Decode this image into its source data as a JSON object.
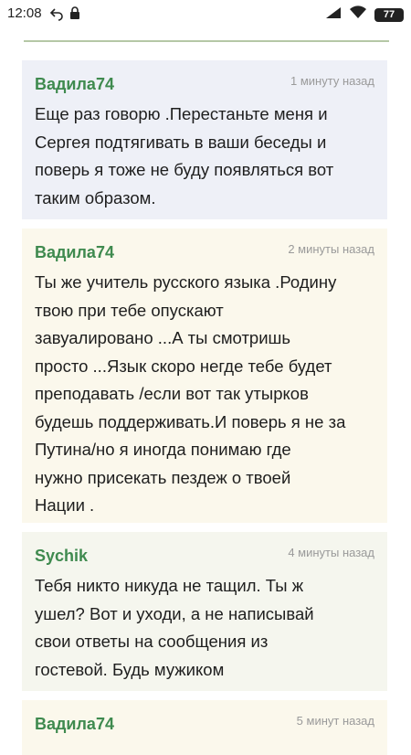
{
  "status_bar": {
    "time": "12:08",
    "icons": [
      "back-arrow-icon",
      "lock-icon",
      "signal-icon",
      "wifi-icon",
      "battery-icon"
    ],
    "battery": "77"
  },
  "comments": [
    {
      "author": "Вадила74",
      "time": "1 минуту назад",
      "lines": [
        "Еще раз говорю .Перестаньте меня и",
        "Сергея подтягивать в ваши беседы и",
        "поверь я тоже не буду появляться вот",
        "таким образом."
      ]
    },
    {
      "author": "Вадила74",
      "time": "2 минуты назад",
      "lines": [
        "Ты же учитель русского языка .Родину",
        "твою при тебе опускают",
        "завуалировано ...А ты смотришь",
        "просто ...Язык скоро негде тебе будет",
        "преподавать /если вот так утырков",
        "будешь поддерживать.И поверь я не за",
        "Путина/но я иногда понимаю где",
        "нужно присекать пездеж о твоей",
        "Нации ."
      ]
    },
    {
      "author": "Sychik",
      "time": "4 минуты назад",
      "lines": [
        "Тебя никто никуда не тащил. Ты ж",
        "ушел? Вот и уходи, а не написывай",
        "свои ответы на сообщения из",
        "гостевой. Будь мужиком"
      ]
    },
    {
      "author": "Вадила74",
      "time": "5 минут назад",
      "lines": []
    }
  ],
  "colors": {
    "author": "#3f8a4f",
    "comment_bg_1": "#eef0f7",
    "comment_bg_2": "#fbf8ec",
    "divider": "#b5c8a6"
  }
}
